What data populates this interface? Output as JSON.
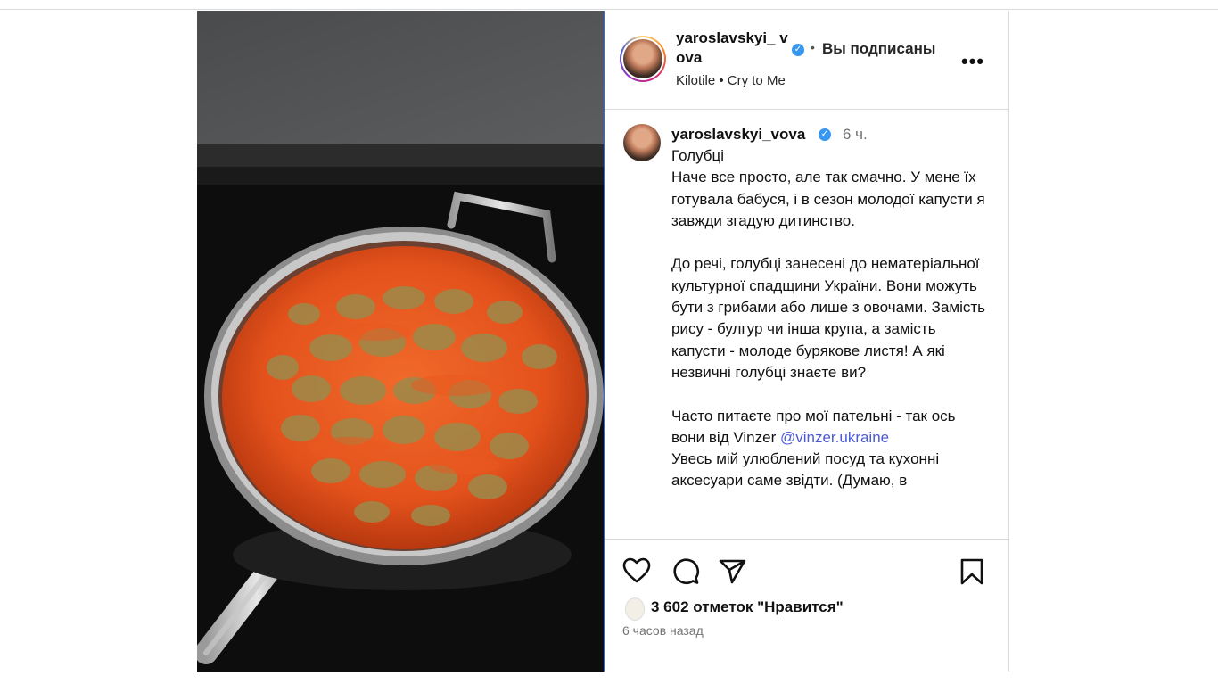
{
  "header": {
    "username": "yaroslavskyi_ vova",
    "separator": "•",
    "follow_status": "Вы подписаны",
    "music": "Kilotile • Cry to Me",
    "more": "•••",
    "verified_icon": "✓"
  },
  "caption": {
    "username": "yaroslavskyi_vova",
    "time": "6 ч.",
    "paragraphs": [
      "Голубці\nНаче все просто, але так смачно. У мене їх готувала бабуся, і в сезон молодої капусти я завжди згадую дитинство.",
      "До речі, голубці занесені до нематеріальної культурної спадщини України. Вони можуть бути з грибами або лише з овочами. Замість рису - булгур чи інша крупа, а замість капусти - молоде бурякове листя! А які незвичні голубці знаєте ви?"
    ],
    "last_para_before": "Часто питаєте про мої пательні - так ось вони від Vinzer ",
    "mention": "@vinzer.ukraine",
    "last_para_after": "Увесь мій улюблений посуд та кухонні аксесуари саме звідти. (Думаю, в"
  },
  "actions": {
    "likes": "3 602 отметок \"Нравится\"",
    "posted": "6 часов назад"
  },
  "icons": [
    "heart-icon",
    "comment-icon",
    "share-icon",
    "bookmark-icon"
  ]
}
